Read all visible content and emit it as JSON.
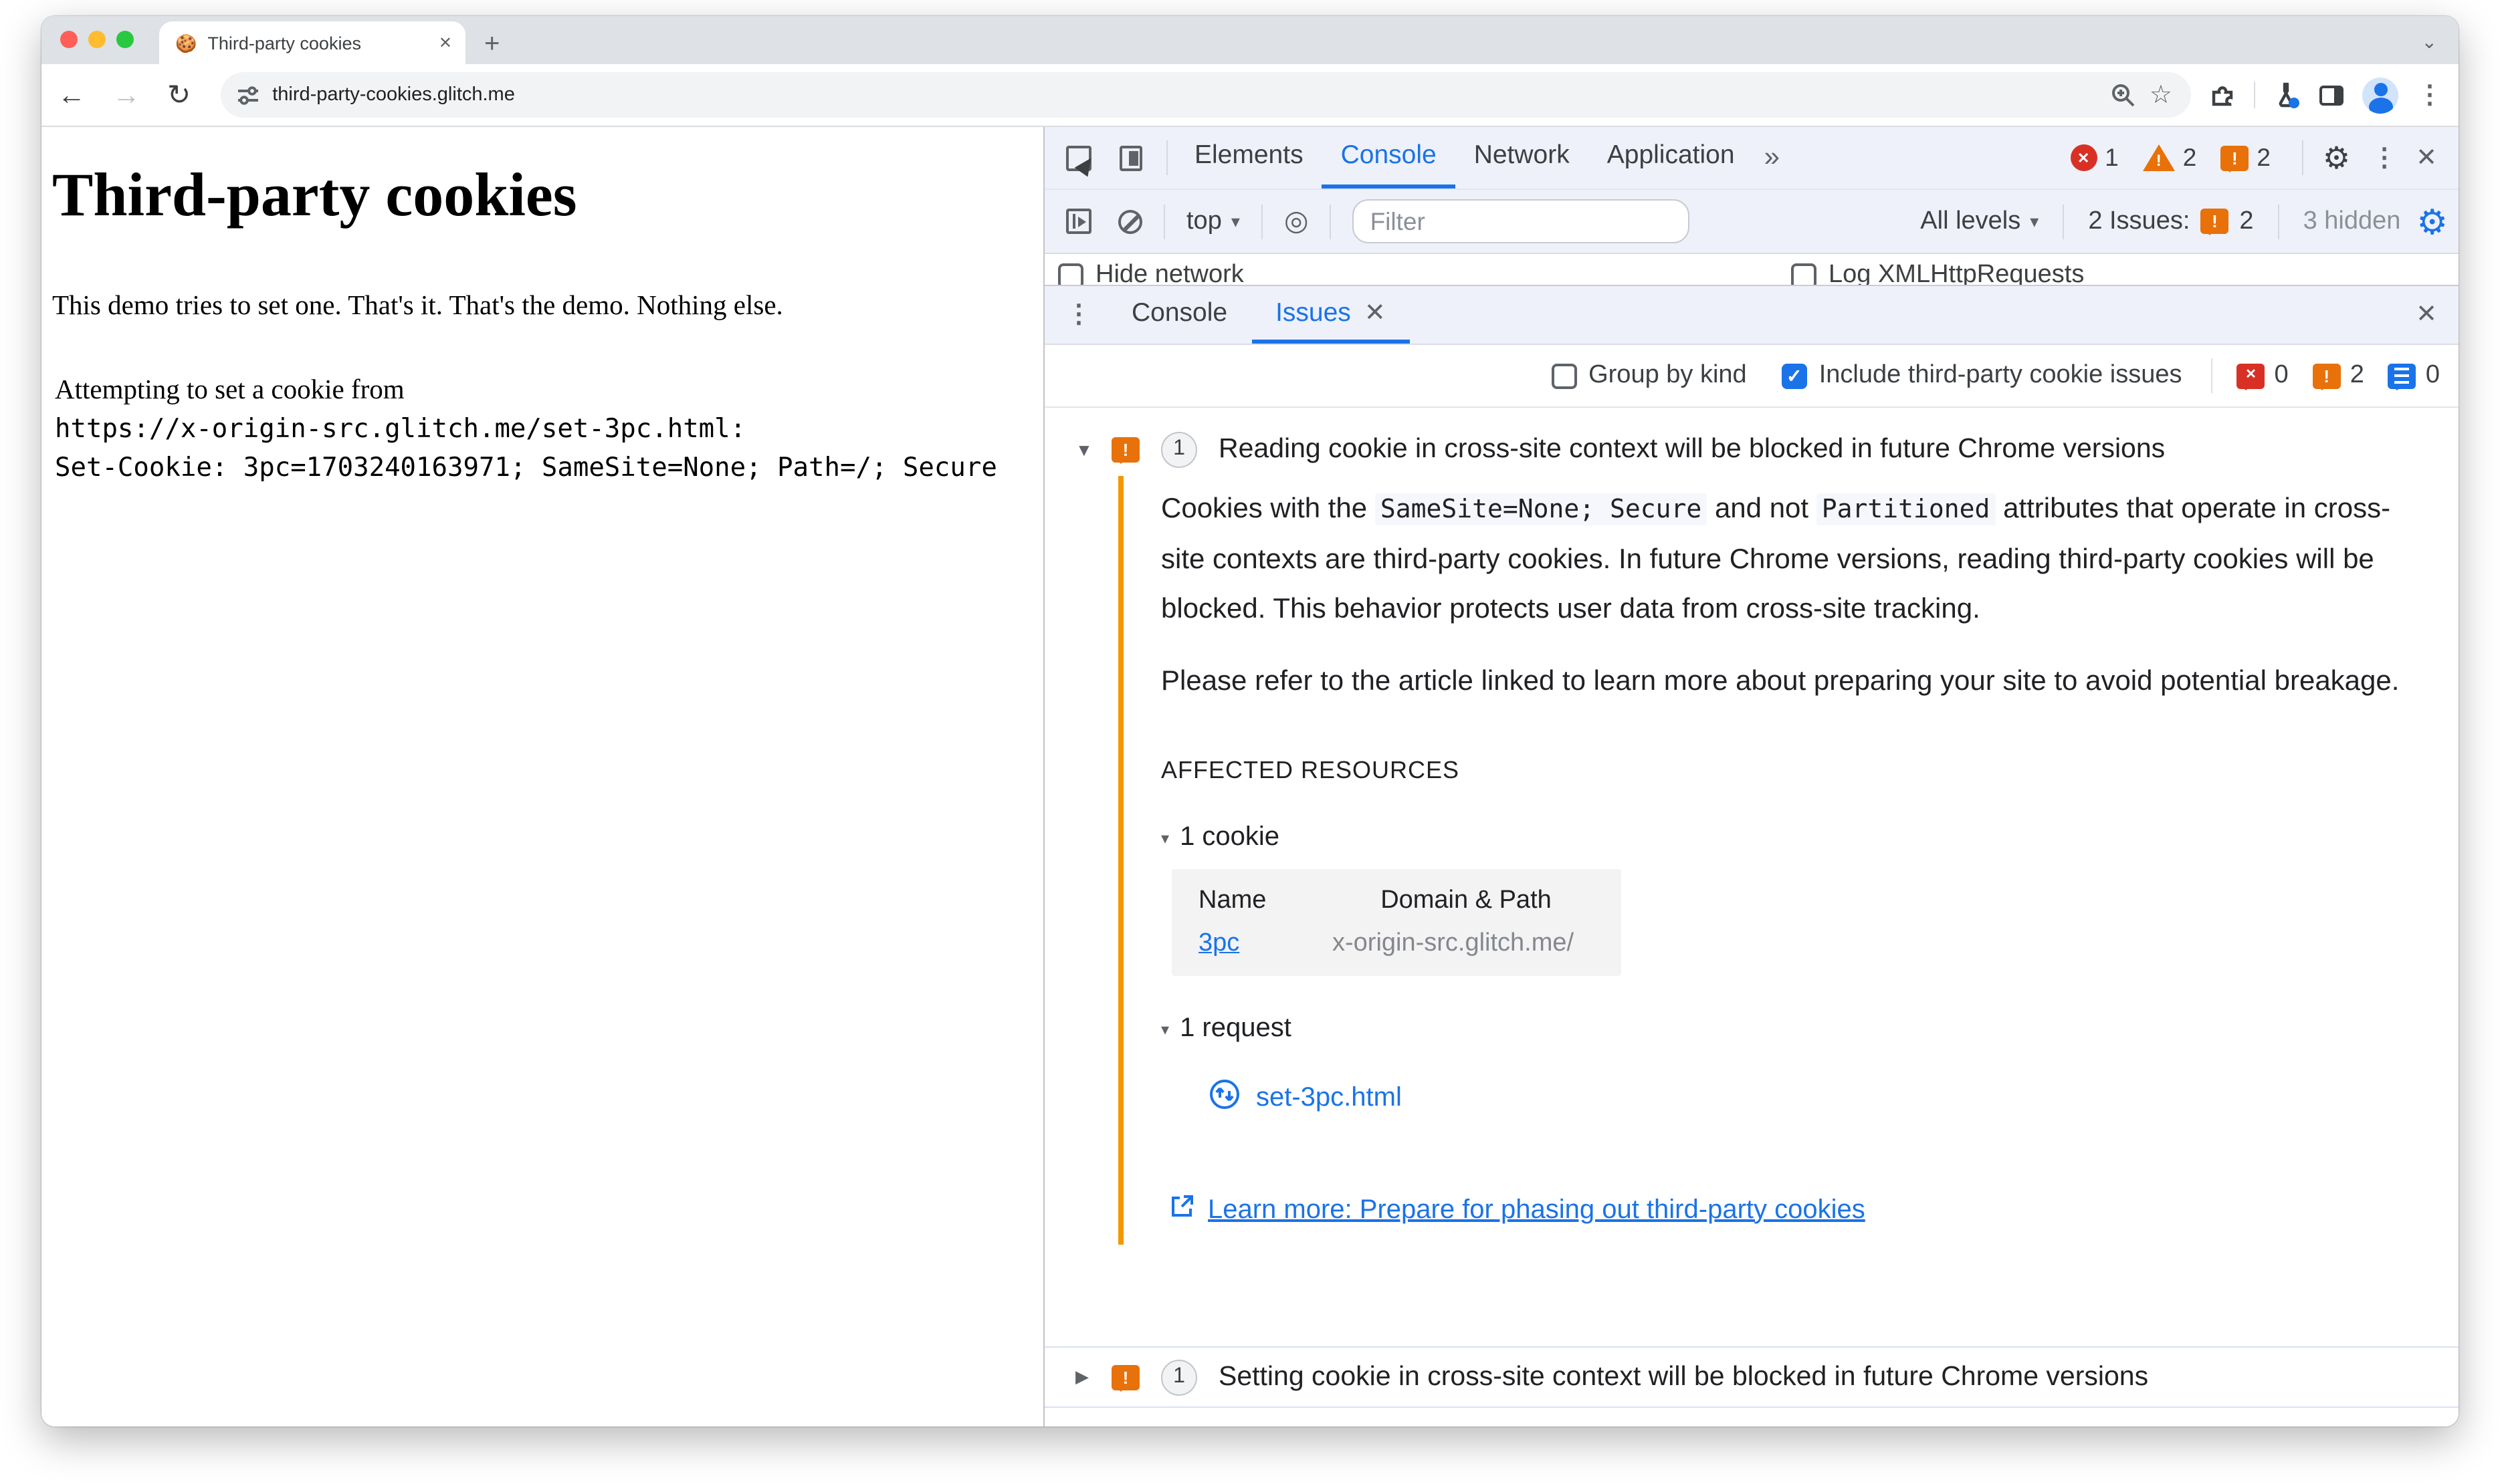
{
  "icons": {
    "back": "←",
    "forward": "→",
    "reload": "↻",
    "star": "☆",
    "kebab": "⋮",
    "gear": "⚙",
    "eye": "◎",
    "more_tabs": "»",
    "tab_search": "⌄",
    "expand_open": "▼",
    "expand_closed": "▶",
    "section_open": "▾",
    "close": "✕",
    "new_tab": "+",
    "check": "✓",
    "bang": "!",
    "dropdown": "▾"
  },
  "browser": {
    "tab": {
      "favicon": "🍪",
      "title": "Third-party cookies"
    },
    "url": "third-party-cookies.glitch.me"
  },
  "page": {
    "heading": "Third-party cookies",
    "intro": "This demo tries to set one. That's it. That's the demo. Nothing else.",
    "attempt_line": "Attempting to set a cookie from",
    "cookie_url": "https://x-origin-src.glitch.me/set-3pc.html:",
    "set_cookie_line": "Set-Cookie: 3pc=1703240163971; SameSite=None; Path=/; Secure"
  },
  "devtools": {
    "main_tabs": {
      "elements": "Elements",
      "console": "Console",
      "network": "Network",
      "application": "Application"
    },
    "badges": {
      "errors": "1",
      "warnings": "2",
      "issues": "2"
    },
    "toolbar": {
      "context": "top",
      "filter_placeholder": "Filter",
      "levels": "All levels",
      "issues_label": "2 Issues:",
      "issues_count": "2",
      "hidden": "3 hidden"
    },
    "console_settings": {
      "hide_network": "Hide network",
      "log_xhr": "Log XMLHttpRequests"
    },
    "drawer": {
      "console": "Console",
      "issues": "Issues"
    },
    "issues_bar": {
      "group": "Group by kind",
      "include": "Include third-party cookie issues",
      "errors": "0",
      "warnings": "2",
      "info": "0"
    },
    "issue1": {
      "count": "1",
      "title": "Reading cookie in cross-site context will be blocked in future Chrome versions",
      "p1a": "Cookies with the ",
      "code1": "SameSite=None; Secure",
      "p1b": " and not ",
      "code2": "Partitioned",
      "p1c": " attributes that operate in cross-site contexts are third-party cookies. In future Chrome versions, reading third-party cookies will be blocked. This behavior protects user data from cross-site tracking.",
      "p2": "Please refer to the article linked to learn more about preparing your site to avoid potential breakage.",
      "affected": "AFFECTED RESOURCES",
      "cookie_count": "1 cookie",
      "table_name": "Name",
      "table_domain": "Domain & Path",
      "cookie_name": "3pc",
      "cookie_domain": "x-origin-src.glitch.me/",
      "request_count": "1 request",
      "request": "set-3pc.html",
      "learn_more": "Learn more: Prepare for phasing out third-party cookies"
    },
    "issue2": {
      "count": "1",
      "title": "Setting cookie in cross-site context will be blocked in future Chrome versions"
    }
  },
  "colors": {
    "accent_blue": "#1a73e8",
    "issue_orange": "#e8710a",
    "error_red": "#d93025",
    "issue_border": "#f29900"
  }
}
